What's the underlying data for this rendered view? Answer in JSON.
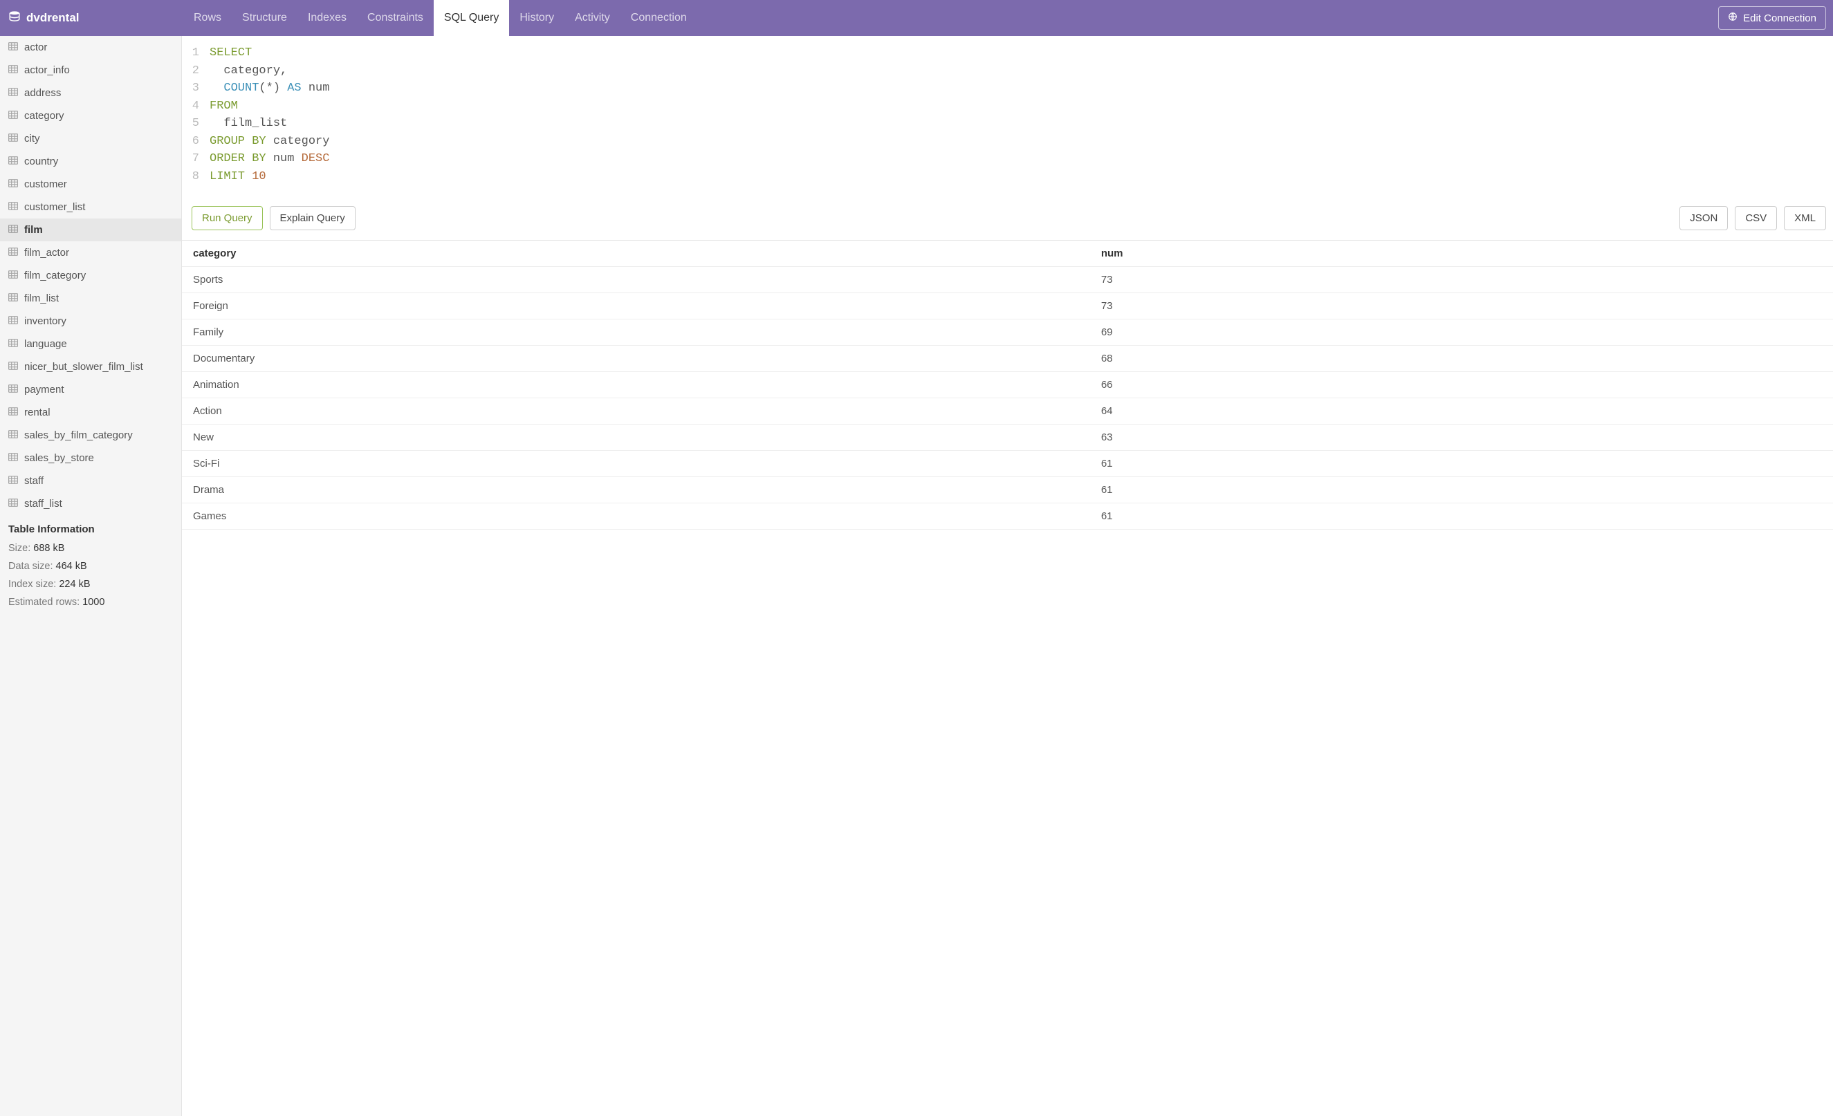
{
  "header": {
    "brand": "dvdrental",
    "tabs": [
      {
        "label": "Rows",
        "active": false
      },
      {
        "label": "Structure",
        "active": false
      },
      {
        "label": "Indexes",
        "active": false
      },
      {
        "label": "Constraints",
        "active": false
      },
      {
        "label": "SQL Query",
        "active": true
      },
      {
        "label": "History",
        "active": false
      },
      {
        "label": "Activity",
        "active": false
      },
      {
        "label": "Connection",
        "active": false
      }
    ],
    "edit_connection": "Edit Connection"
  },
  "sidebar": {
    "items": [
      {
        "name": "actor",
        "active": false
      },
      {
        "name": "actor_info",
        "active": false
      },
      {
        "name": "address",
        "active": false
      },
      {
        "name": "category",
        "active": false
      },
      {
        "name": "city",
        "active": false
      },
      {
        "name": "country",
        "active": false
      },
      {
        "name": "customer",
        "active": false
      },
      {
        "name": "customer_list",
        "active": false
      },
      {
        "name": "film",
        "active": true
      },
      {
        "name": "film_actor",
        "active": false
      },
      {
        "name": "film_category",
        "active": false
      },
      {
        "name": "film_list",
        "active": false
      },
      {
        "name": "inventory",
        "active": false
      },
      {
        "name": "language",
        "active": false
      },
      {
        "name": "nicer_but_slower_film_list",
        "active": false
      },
      {
        "name": "payment",
        "active": false
      },
      {
        "name": "rental",
        "active": false
      },
      {
        "name": "sales_by_film_category",
        "active": false
      },
      {
        "name": "sales_by_store",
        "active": false
      },
      {
        "name": "staff",
        "active": false
      },
      {
        "name": "staff_list",
        "active": false
      }
    ],
    "info": {
      "title": "Table Information",
      "rows": [
        {
          "label": "Size:",
          "value": "688 kB"
        },
        {
          "label": "Data size:",
          "value": "464 kB"
        },
        {
          "label": "Index size:",
          "value": "224 kB"
        },
        {
          "label": "Estimated rows:",
          "value": "1000"
        }
      ]
    }
  },
  "editor": {
    "lines": [
      {
        "n": "1",
        "tokens": [
          {
            "cls": "kw",
            "t": "SELECT"
          }
        ]
      },
      {
        "n": "2",
        "tokens": [
          {
            "cls": "",
            "t": "  "
          },
          {
            "cls": "ident",
            "t": "category,"
          }
        ]
      },
      {
        "n": "3",
        "tokens": [
          {
            "cls": "",
            "t": "  "
          },
          {
            "cls": "kw2",
            "t": "COUNT"
          },
          {
            "cls": "ident",
            "t": "(*) "
          },
          {
            "cls": "kw2",
            "t": "AS"
          },
          {
            "cls": "ident",
            "t": " num"
          }
        ]
      },
      {
        "n": "4",
        "tokens": [
          {
            "cls": "kw",
            "t": "FROM"
          }
        ]
      },
      {
        "n": "5",
        "tokens": [
          {
            "cls": "",
            "t": "  "
          },
          {
            "cls": "ident",
            "t": "film_list"
          }
        ]
      },
      {
        "n": "6",
        "tokens": [
          {
            "cls": "kw",
            "t": "GROUP BY"
          },
          {
            "cls": "ident",
            "t": " category"
          }
        ]
      },
      {
        "n": "7",
        "tokens": [
          {
            "cls": "kw",
            "t": "ORDER BY"
          },
          {
            "cls": "ident",
            "t": " num "
          },
          {
            "cls": "kw3",
            "t": "DESC"
          }
        ]
      },
      {
        "n": "8",
        "tokens": [
          {
            "cls": "kw",
            "t": "LIMIT"
          },
          {
            "cls": "",
            "t": " "
          },
          {
            "cls": "kw3",
            "t": "10"
          }
        ]
      }
    ]
  },
  "toolbar": {
    "run": "Run Query",
    "explain": "Explain Query",
    "json": "JSON",
    "csv": "CSV",
    "xml": "XML"
  },
  "results": {
    "columns": [
      "category",
      "num"
    ],
    "rows": [
      {
        "category": "Sports",
        "num": "73"
      },
      {
        "category": "Foreign",
        "num": "73"
      },
      {
        "category": "Family",
        "num": "69"
      },
      {
        "category": "Documentary",
        "num": "68"
      },
      {
        "category": "Animation",
        "num": "66"
      },
      {
        "category": "Action",
        "num": "64"
      },
      {
        "category": "New",
        "num": "63"
      },
      {
        "category": "Sci-Fi",
        "num": "61"
      },
      {
        "category": "Drama",
        "num": "61"
      },
      {
        "category": "Games",
        "num": "61"
      }
    ]
  }
}
